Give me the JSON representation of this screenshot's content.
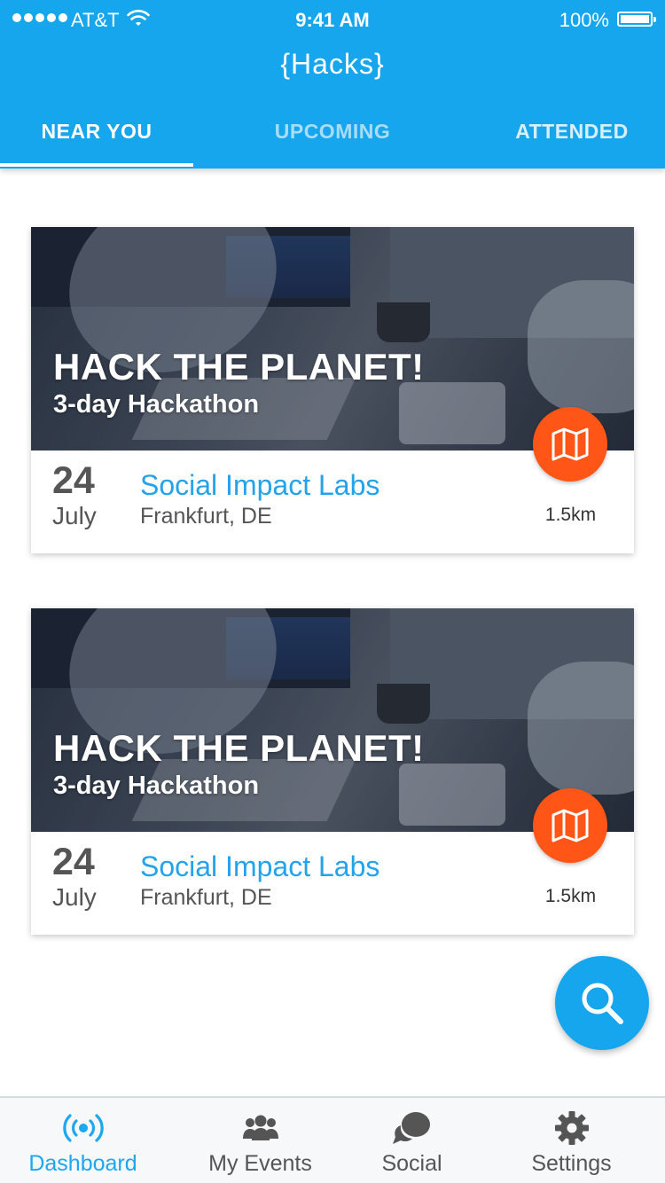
{
  "status_bar": {
    "carrier": "AT&T",
    "time": "9:41 AM",
    "battery": "100%"
  },
  "app": {
    "title": "{Hacks}"
  },
  "tabs": [
    {
      "label": "NEAR YOU",
      "active": true
    },
    {
      "label": "UPCOMING",
      "active": false
    },
    {
      "label": "ATTENDED",
      "active": false
    }
  ],
  "events": [
    {
      "title": "HACK THE PLANET!",
      "subtitle": "3-day Hackathon",
      "day": "24",
      "month": "July",
      "venue": "Social Impact Labs",
      "location": "Frankfurt, DE",
      "distance": "1.5km"
    },
    {
      "title": "HACK THE PLANET!",
      "subtitle": "3-day Hackathon",
      "day": "24",
      "month": "July",
      "venue": "Social Impact Labs",
      "location": "Frankfurt, DE",
      "distance": "1.5km"
    }
  ],
  "fab": {
    "icon": "search-icon"
  },
  "bottom_nav": [
    {
      "label": "Dashboard",
      "icon": "broadcast-icon",
      "active": true
    },
    {
      "label": "My Events",
      "icon": "people-icon",
      "active": false
    },
    {
      "label": "Social",
      "icon": "chat-bubbles-icon",
      "active": false
    },
    {
      "label": "Settings",
      "icon": "gear-icon",
      "active": false
    }
  ],
  "colors": {
    "primary": "#16a6ee",
    "accent": "#ff5516",
    "venue_text": "#23a3ec"
  }
}
